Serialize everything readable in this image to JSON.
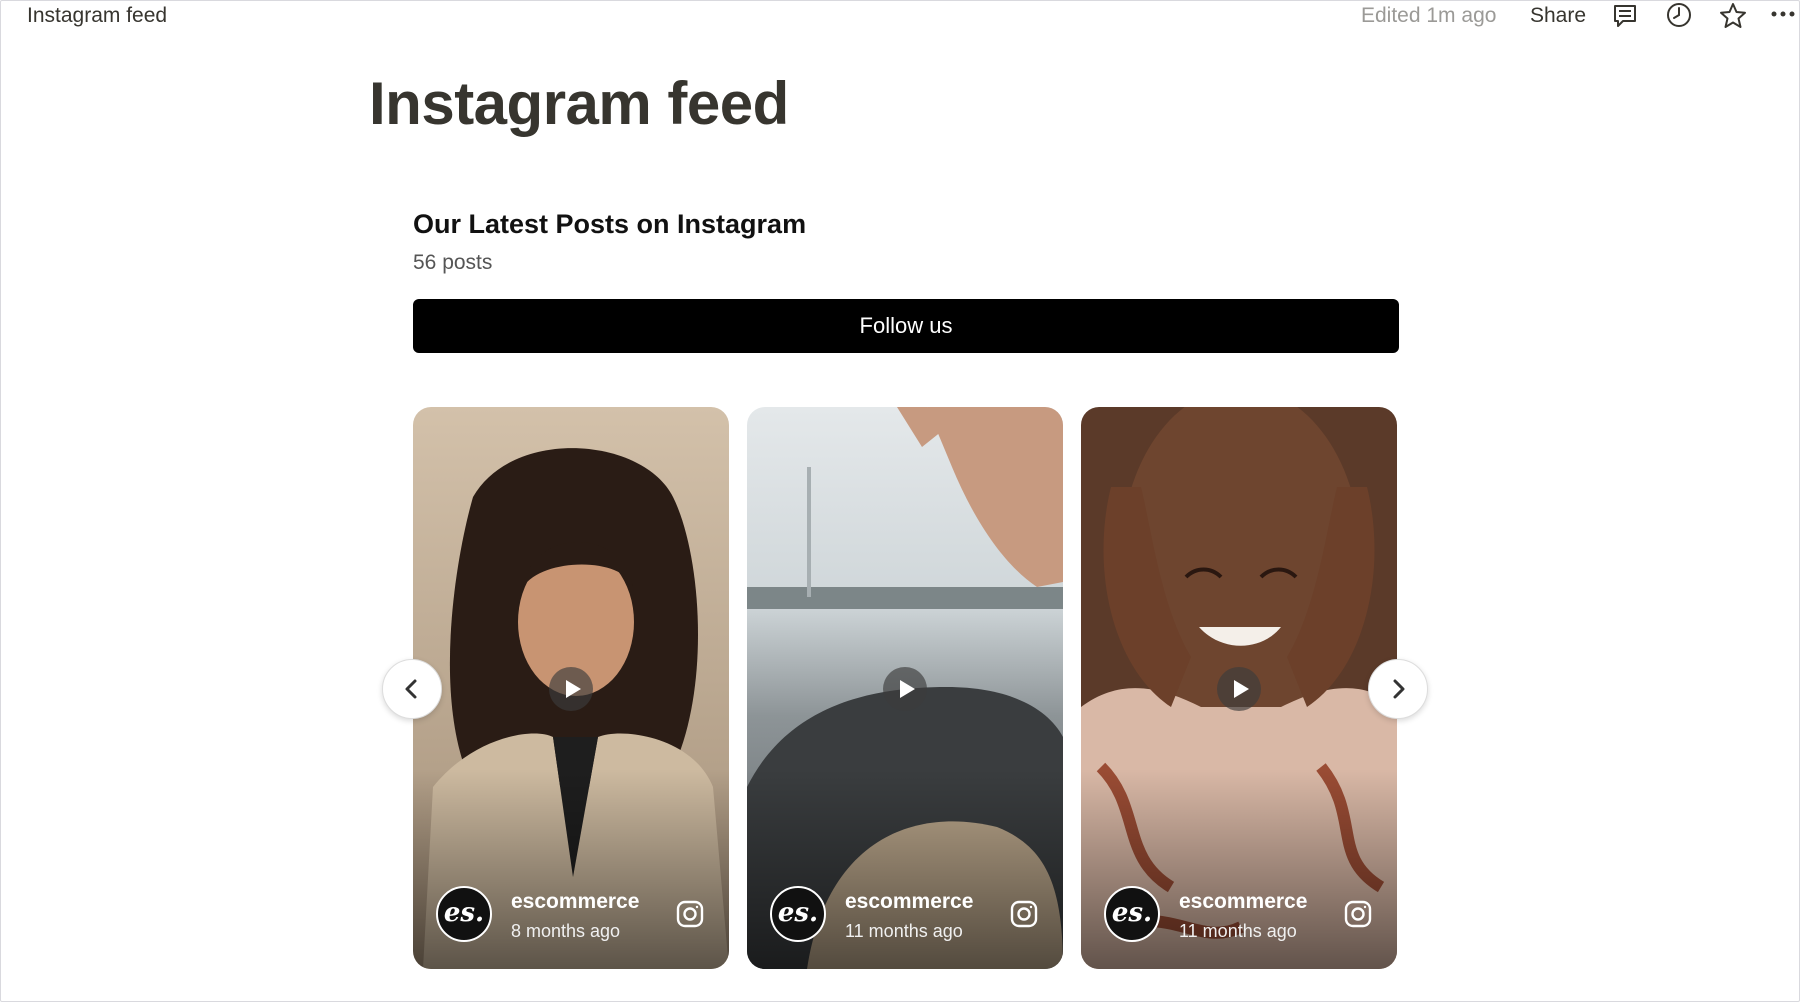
{
  "topbar": {
    "breadcrumb": "Instagram feed",
    "edited": "Edited 1m ago",
    "share_label": "Share",
    "icons": [
      "comment-icon",
      "clock-icon",
      "star-icon",
      "more-icon"
    ]
  },
  "page": {
    "title": "Instagram feed"
  },
  "widget": {
    "heading": "Our Latest Posts on Instagram",
    "post_count": "56 posts",
    "follow_label": "Follow us",
    "posts": [
      {
        "avatar_text": "es.",
        "username": "escommerce",
        "age": "8 months ago",
        "media": "video"
      },
      {
        "avatar_text": "es.",
        "username": "escommerce",
        "age": "11 months ago",
        "media": "video"
      },
      {
        "avatar_text": "es.",
        "username": "escommerce",
        "age": "11 months ago",
        "media": "video"
      }
    ]
  },
  "colors": {
    "follow_bg": "#000000",
    "title_text": "#37352f",
    "muted_text": "#9b9a97"
  }
}
